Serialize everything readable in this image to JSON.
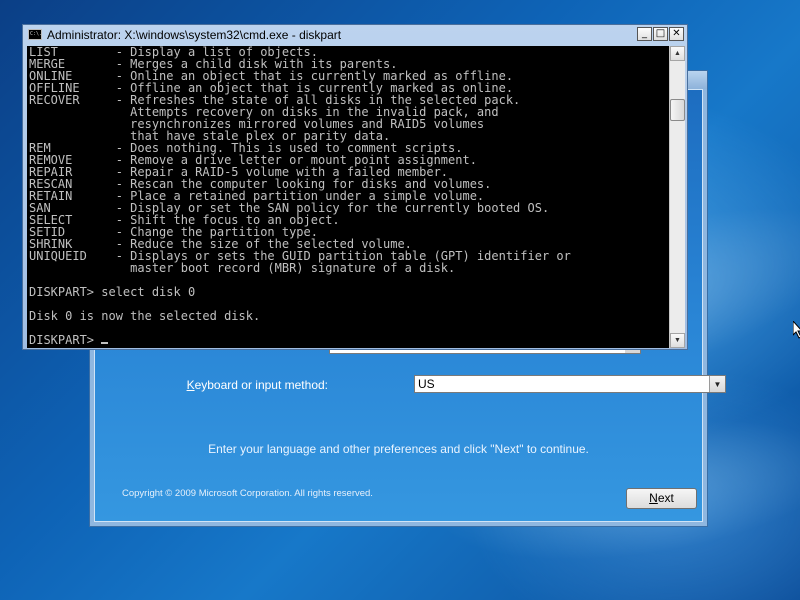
{
  "setup": {
    "keyboard_label_underlined": "K",
    "keyboard_label_rest": "eyboard or input method:",
    "keyboard_value": "US",
    "prompt": "Enter your language and other preferences and click \"Next\" to continue.",
    "copyright": "Copyright © 2009 Microsoft Corporation. All rights reserved.",
    "next_label_underlined": "N",
    "next_label_rest": "ext"
  },
  "cmd": {
    "icon_text": "C:\\.",
    "title": "Administrator: X:\\windows\\system32\\cmd.exe - diskpart",
    "minimize_glyph": "_",
    "maximize_glyph": "□",
    "close_glyph": "✕",
    "lines": [
      "LIST        - Display a list of objects.",
      "MERGE       - Merges a child disk with its parents.",
      "ONLINE      - Online an object that is currently marked as offline.",
      "OFFLINE     - Offline an object that is currently marked as online.",
      "RECOVER     - Refreshes the state of all disks in the selected pack.",
      "              Attempts recovery on disks in the invalid pack, and",
      "              resynchronizes mirrored volumes and RAID5 volumes",
      "              that have stale plex or parity data.",
      "REM         - Does nothing. This is used to comment scripts.",
      "REMOVE      - Remove a drive letter or mount point assignment.",
      "REPAIR      - Repair a RAID-5 volume with a failed member.",
      "RESCAN      - Rescan the computer looking for disks and volumes.",
      "RETAIN      - Place a retained partition under a simple volume.",
      "SAN         - Display or set the SAN policy for the currently booted OS.",
      "SELECT      - Shift the focus to an object.",
      "SETID       - Change the partition type.",
      "SHRINK      - Reduce the size of the selected volume.",
      "UNIQUEID    - Displays or sets the GUID partition table (GPT) identifier or",
      "              master boot record (MBR) signature of a disk.",
      "",
      "DISKPART> select disk 0",
      "",
      "Disk 0 is now the selected disk.",
      ""
    ],
    "prompt": "DISKPART> "
  },
  "icons": {
    "scroll_up": "▲",
    "scroll_down": "▼",
    "dropdown": "▼"
  },
  "scroll_position": 0.15
}
